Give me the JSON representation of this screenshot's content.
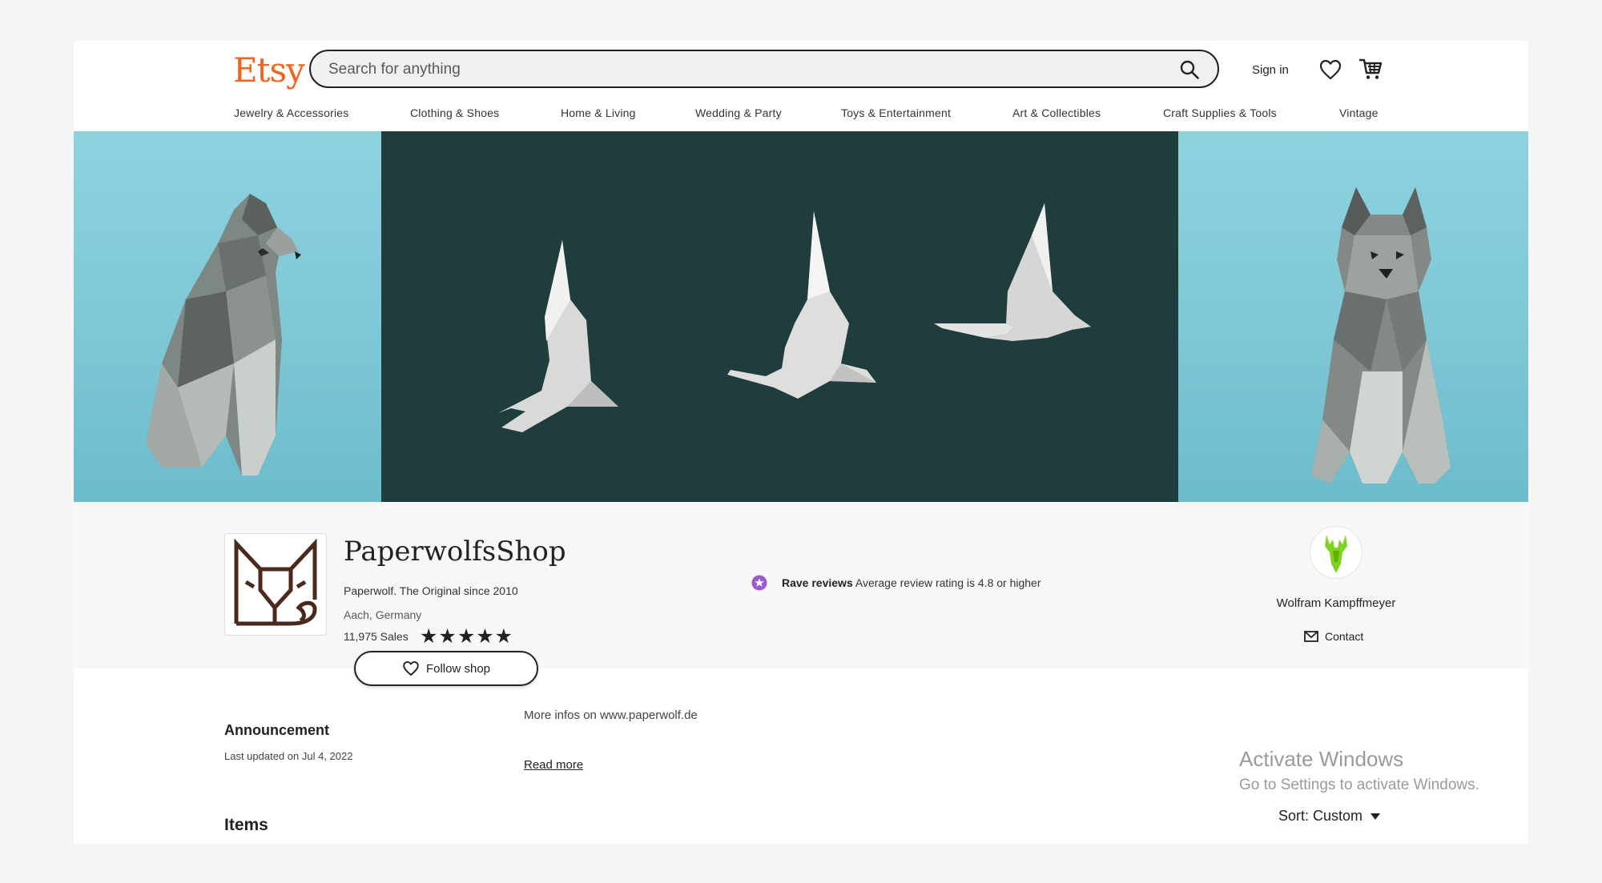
{
  "header": {
    "logo": "Etsy",
    "search_placeholder": "Search for anything",
    "sign_in": "Sign in"
  },
  "nav": {
    "items": [
      {
        "label": "Jewelry & Accessories"
      },
      {
        "label": "Clothing & Shoes"
      },
      {
        "label": "Home & Living"
      },
      {
        "label": "Wedding & Party"
      },
      {
        "label": "Toys & Entertainment"
      },
      {
        "label": "Art & Collectibles"
      },
      {
        "label": "Craft Supplies & Tools"
      },
      {
        "label": "Vintage"
      }
    ]
  },
  "shop": {
    "name": "PaperwolfsShop",
    "tagline": "Paperwolf. The Original since 2010",
    "location": "Aach, Germany",
    "sales": "11,975 Sales",
    "rating_stars": 5,
    "stars_display": "★★★★★",
    "follow_label": "Follow shop"
  },
  "badge": {
    "title": "Rave reviews",
    "text": "Average review rating is 4.8 or higher",
    "color": "#9b59d0"
  },
  "owner": {
    "name": "Wolfram Kampffmeyer",
    "contact_label": "Contact"
  },
  "announcement": {
    "title": "Announcement",
    "updated": "Last updated on Jul 4, 2022",
    "text": "More infos on www.paperwolf.de",
    "read_more": "Read more"
  },
  "items": {
    "title": "Items",
    "sort_label": "Sort: Custom"
  },
  "watermark": {
    "line1": "Activate Windows",
    "line2": "Go to Settings to activate Windows."
  },
  "colors": {
    "brand": "#f1641e",
    "banner_teal": "#1f3d3c",
    "banner_sky": "#7fcad9"
  }
}
